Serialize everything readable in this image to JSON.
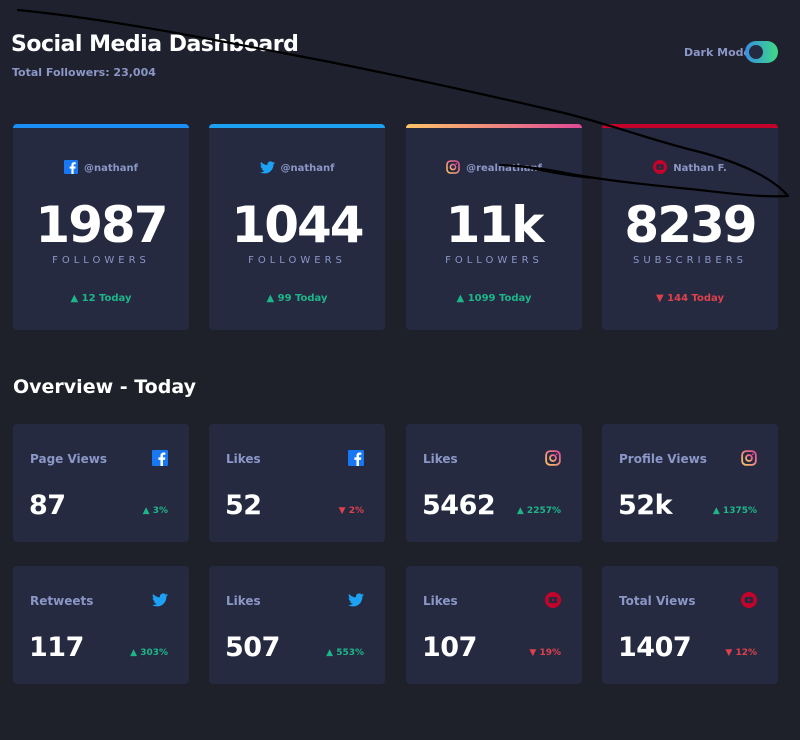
{
  "header": {
    "title": "Social Media Dashboard",
    "total_followers": "Total Followers: 23,004",
    "toggle_label": "Dark Mode"
  },
  "cards": [
    {
      "network": "facebook",
      "icon": "facebook-icon",
      "handle": "@nathanf",
      "count": "1987",
      "unit": "FOLLOWERS",
      "change": "▲ 12 Today",
      "trend": "up",
      "accent": "#198ff5"
    },
    {
      "network": "twitter",
      "icon": "twitter-icon",
      "handle": "@nathanf",
      "count": "1044",
      "unit": "FOLLOWERS",
      "change": "▲ 99 Today",
      "trend": "up",
      "accent": "#1ca0f2"
    },
    {
      "network": "instagram",
      "icon": "instagram-icon",
      "handle": "@realnathanf",
      "count": "11k",
      "unit": "FOLLOWERS",
      "change": "▲ 1099 Today",
      "trend": "up",
      "accent": "#df4996"
    },
    {
      "network": "youtube",
      "icon": "youtube-icon",
      "handle": "Nathan F.",
      "count": "8239",
      "unit": "SUBSCRIBERS",
      "change": "▼ 144 Today",
      "trend": "down",
      "accent": "#c4032a"
    }
  ],
  "overview": {
    "title": "Overview - Today",
    "items": [
      {
        "label": "Page Views",
        "icon": "facebook-icon",
        "value": "87",
        "change": "▲ 3%",
        "trend": "up"
      },
      {
        "label": "Likes",
        "icon": "facebook-icon",
        "value": "52",
        "change": "▼ 2%",
        "trend": "down"
      },
      {
        "label": "Likes",
        "icon": "instagram-icon",
        "value": "5462",
        "change": "▲ 2257%",
        "trend": "up"
      },
      {
        "label": "Profile Views",
        "icon": "instagram-icon",
        "value": "52k",
        "change": "▲ 1375%",
        "trend": "up"
      },
      {
        "label": "Retweets",
        "icon": "twitter-icon",
        "value": "117",
        "change": "▲ 303%",
        "trend": "up"
      },
      {
        "label": "Likes",
        "icon": "twitter-icon",
        "value": "507",
        "change": "▲ 553%",
        "trend": "up"
      },
      {
        "label": "Likes",
        "icon": "youtube-icon",
        "value": "107",
        "change": "▼ 19%",
        "trend": "down"
      },
      {
        "label": "Total Views",
        "icon": "youtube-icon",
        "value": "1407",
        "change": "▼ 12%",
        "trend": "down"
      }
    ]
  },
  "colors": {
    "background": "#1e202a",
    "card": "#252a41",
    "muted_text": "#8b97c6",
    "up": "#1eb589",
    "down": "#dc414c",
    "instagram_gradient": [
      "#fdc468",
      "#df4996"
    ],
    "toggle_gradient": [
      "#378fe6",
      "#3eda82"
    ]
  }
}
